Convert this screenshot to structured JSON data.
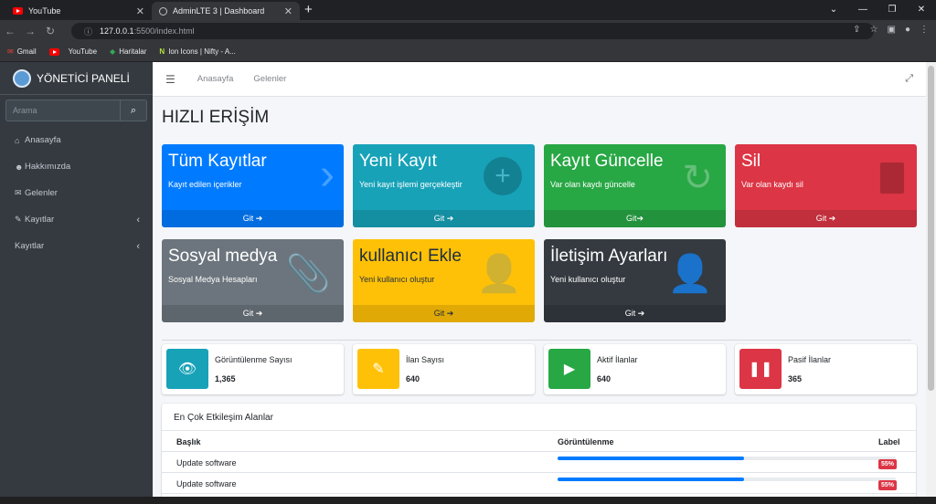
{
  "browser": {
    "tabs": [
      {
        "title": "YouTube"
      },
      {
        "title": "AdminLTE 3 | Dashboard"
      }
    ],
    "url_host": "127.0.0.1",
    "url_path": ":5500/index.html",
    "bookmarks": [
      "Gmail",
      "YouTube",
      "Haritalar",
      "Ion Icons | Nifty - A..."
    ]
  },
  "sidebar": {
    "brand": "YÖNETİCİ PANELİ",
    "search_placeholder": "Arama",
    "items": [
      {
        "label": "Anasayfa",
        "icon": "home-icon"
      },
      {
        "label": "Hakkımızda",
        "icon": "users-icon"
      },
      {
        "label": "Gelenler",
        "icon": "envelope-icon"
      },
      {
        "label": "Kayıtlar",
        "icon": "pencil-icon",
        "chevron": true
      },
      {
        "label": "Kayıtlar",
        "chevron": true
      }
    ]
  },
  "header": {
    "links": [
      "Anasayfa",
      "Gelenler"
    ]
  },
  "page_title": "HIZLI ERİŞİM",
  "cards": [
    {
      "title": "Tüm Kayıtlar",
      "text": "Kayıt edilen içerikler",
      "footer": "Git ➔",
      "color": "#007bff",
      "icon": "chevron-right-icon"
    },
    {
      "title": "Yeni Kayıt",
      "text": "Yeni kayıt işlemi gerçekleştir",
      "footer": "Git ➔",
      "color": "#17a2b8",
      "icon": "plus-circle-icon"
    },
    {
      "title": "Kayıt Güncelle",
      "text": "Var olan kaydı güncelle",
      "footer": "Git➔",
      "color": "#28a745",
      "icon": "refresh-icon"
    },
    {
      "title": "Sil",
      "text": "Var olan kaydı sil",
      "footer": "Git ➔",
      "color": "#dc3545",
      "icon": "trash-icon"
    },
    {
      "title": "Sosyal medya",
      "text": "Sosyal Medya Hesapları",
      "footer": "Git ➔",
      "color": "#6c757d",
      "icon": "paperclip-icon"
    },
    {
      "title": "kullanıcı Ekle",
      "text": "Yeni kullanıcı oluştur",
      "footer": "Git ➔",
      "color": "#ffc107",
      "icon": "user-plus-icon"
    },
    {
      "title": "İletişim Ayarları",
      "text": "Yeni kullanıcı oluştur",
      "footer": "Git ➔",
      "color": "#343a40",
      "icon": "user-plus-icon"
    }
  ],
  "info": [
    {
      "label": "Görüntülenme Sayısı",
      "value": "1,365",
      "color": "#17a2b8",
      "icon": "eye-icon"
    },
    {
      "label": "İlan Sayısı",
      "value": "640",
      "color": "#ffc107",
      "icon": "edit-icon"
    },
    {
      "label": "Aktif İlanlar",
      "value": "640",
      "color": "#28a745",
      "icon": "play-icon"
    },
    {
      "label": "Pasif İlanlar",
      "value": "365",
      "color": "#dc3545",
      "icon": "pause-icon"
    }
  ],
  "table": {
    "title": "En Çok Etkileşim Alanlar",
    "headers": [
      "Başlık",
      "Görüntülenme",
      "Label"
    ],
    "rows": [
      {
        "title": "Update software",
        "progress": 0.55,
        "label": "55%"
      },
      {
        "title": "Update software",
        "progress": 0.55,
        "label": "55%"
      }
    ]
  }
}
